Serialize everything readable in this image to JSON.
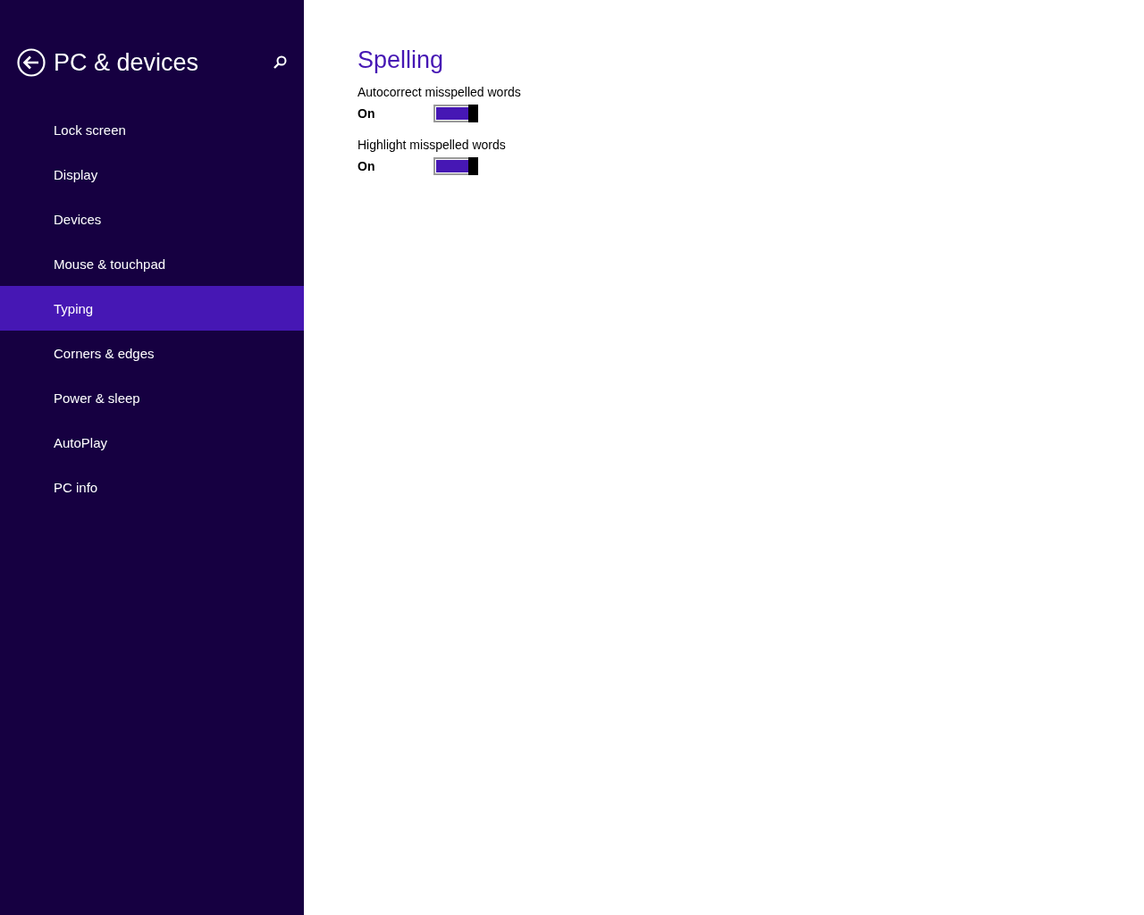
{
  "sidebar": {
    "title": "PC & devices",
    "items": [
      {
        "label": "Lock screen",
        "selected": false
      },
      {
        "label": "Display",
        "selected": false
      },
      {
        "label": "Devices",
        "selected": false
      },
      {
        "label": "Mouse & touchpad",
        "selected": false
      },
      {
        "label": "Typing",
        "selected": true
      },
      {
        "label": "Corners & edges",
        "selected": false
      },
      {
        "label": "Power & sleep",
        "selected": false
      },
      {
        "label": "AutoPlay",
        "selected": false
      },
      {
        "label": "PC info",
        "selected": false
      }
    ]
  },
  "content": {
    "heading": "Spelling",
    "settings": [
      {
        "label": "Autocorrect misspelled words",
        "state": "On",
        "on": true
      },
      {
        "label": "Highlight misspelled words",
        "state": "On",
        "on": true
      }
    ]
  }
}
